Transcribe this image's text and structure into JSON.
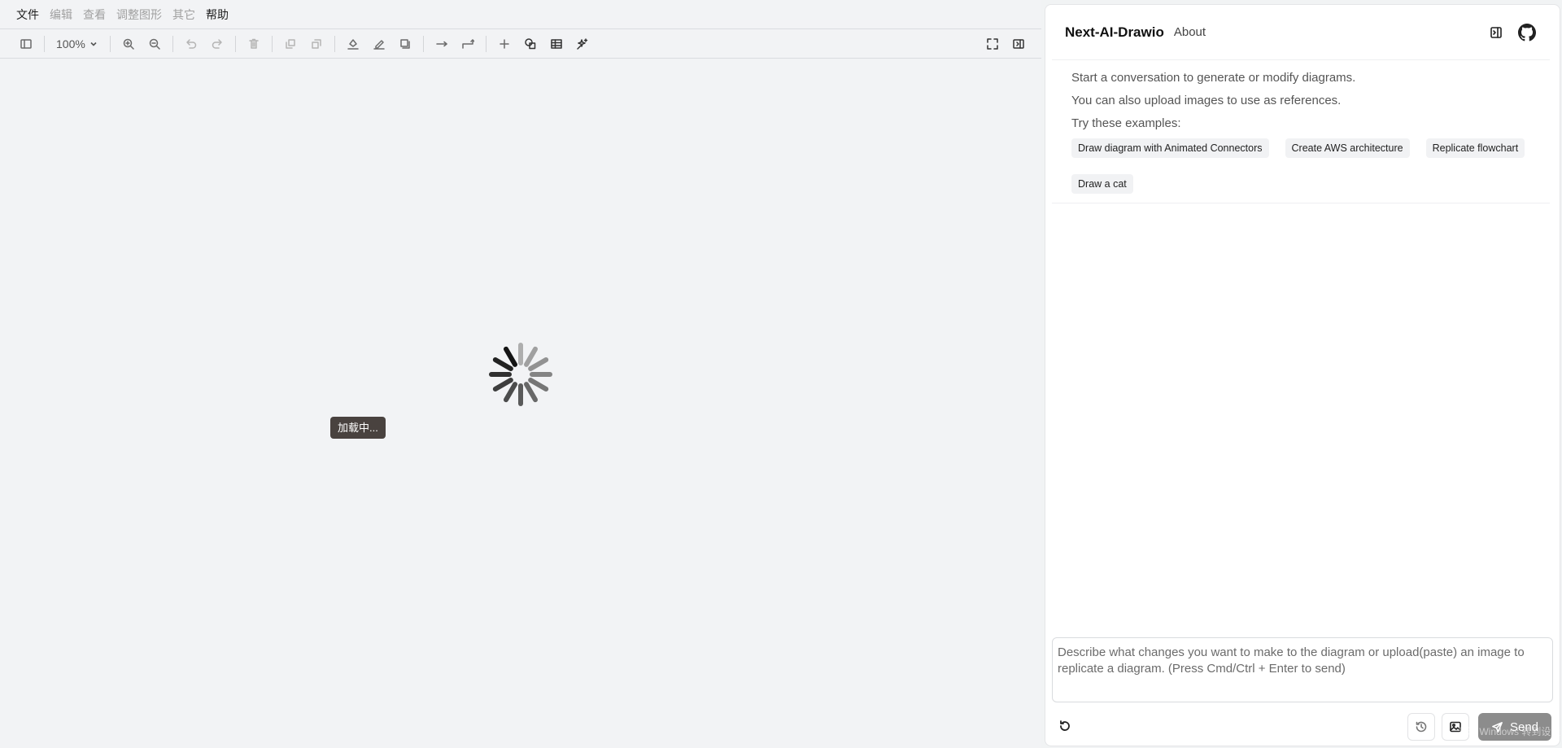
{
  "menubar": {
    "items": [
      {
        "label": "文件",
        "enabled": true
      },
      {
        "label": "编辑",
        "enabled": false
      },
      {
        "label": "查看",
        "enabled": false
      },
      {
        "label": "调整图形",
        "enabled": false
      },
      {
        "label": "其它",
        "enabled": false
      },
      {
        "label": "帮助",
        "enabled": true
      }
    ]
  },
  "toolbar": {
    "zoom": "100%"
  },
  "canvas": {
    "loading_text": "加载中..."
  },
  "chat": {
    "title": "Next-AI-Drawio",
    "about": "About",
    "intro_line1": "Start a conversation to generate or modify diagrams.",
    "intro_line2": "You can also upload images to use as references.",
    "examples_label": "Try these examples:",
    "examples": [
      "Draw diagram with Animated Connectors",
      "Create AWS architecture",
      "Replicate flowchart",
      "Draw a cat"
    ],
    "input_placeholder": "Describe what changes you want to make to the diagram or upload(paste) an image to replicate a diagram. (Press Cmd/Ctrl + Enter to send)",
    "send_label": "Send",
    "overlay_text": "激活 Windows 转到设置"
  },
  "colors": {
    "canvas_bg": "#f2f3f5",
    "send_button": "#8c8c8c",
    "loading_tip_bg": "#49423f"
  }
}
